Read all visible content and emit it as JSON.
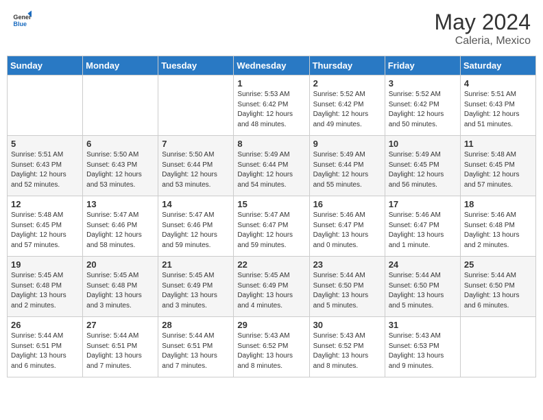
{
  "header": {
    "logo_general": "General",
    "logo_blue": "Blue",
    "month_year": "May 2024",
    "location": "Caleria, Mexico"
  },
  "days_of_week": [
    "Sunday",
    "Monday",
    "Tuesday",
    "Wednesday",
    "Thursday",
    "Friday",
    "Saturday"
  ],
  "weeks": [
    [
      {
        "day": "",
        "sunrise": "",
        "sunset": "",
        "daylight": ""
      },
      {
        "day": "",
        "sunrise": "",
        "sunset": "",
        "daylight": ""
      },
      {
        "day": "",
        "sunrise": "",
        "sunset": "",
        "daylight": ""
      },
      {
        "day": "1",
        "sunrise": "Sunrise: 5:53 AM",
        "sunset": "Sunset: 6:42 PM",
        "daylight": "Daylight: 12 hours and 48 minutes."
      },
      {
        "day": "2",
        "sunrise": "Sunrise: 5:52 AM",
        "sunset": "Sunset: 6:42 PM",
        "daylight": "Daylight: 12 hours and 49 minutes."
      },
      {
        "day": "3",
        "sunrise": "Sunrise: 5:52 AM",
        "sunset": "Sunset: 6:42 PM",
        "daylight": "Daylight: 12 hours and 50 minutes."
      },
      {
        "day": "4",
        "sunrise": "Sunrise: 5:51 AM",
        "sunset": "Sunset: 6:43 PM",
        "daylight": "Daylight: 12 hours and 51 minutes."
      }
    ],
    [
      {
        "day": "5",
        "sunrise": "Sunrise: 5:51 AM",
        "sunset": "Sunset: 6:43 PM",
        "daylight": "Daylight: 12 hours and 52 minutes."
      },
      {
        "day": "6",
        "sunrise": "Sunrise: 5:50 AM",
        "sunset": "Sunset: 6:43 PM",
        "daylight": "Daylight: 12 hours and 53 minutes."
      },
      {
        "day": "7",
        "sunrise": "Sunrise: 5:50 AM",
        "sunset": "Sunset: 6:44 PM",
        "daylight": "Daylight: 12 hours and 53 minutes."
      },
      {
        "day": "8",
        "sunrise": "Sunrise: 5:49 AM",
        "sunset": "Sunset: 6:44 PM",
        "daylight": "Daylight: 12 hours and 54 minutes."
      },
      {
        "day": "9",
        "sunrise": "Sunrise: 5:49 AM",
        "sunset": "Sunset: 6:44 PM",
        "daylight": "Daylight: 12 hours and 55 minutes."
      },
      {
        "day": "10",
        "sunrise": "Sunrise: 5:49 AM",
        "sunset": "Sunset: 6:45 PM",
        "daylight": "Daylight: 12 hours and 56 minutes."
      },
      {
        "day": "11",
        "sunrise": "Sunrise: 5:48 AM",
        "sunset": "Sunset: 6:45 PM",
        "daylight": "Daylight: 12 hours and 57 minutes."
      }
    ],
    [
      {
        "day": "12",
        "sunrise": "Sunrise: 5:48 AM",
        "sunset": "Sunset: 6:45 PM",
        "daylight": "Daylight: 12 hours and 57 minutes."
      },
      {
        "day": "13",
        "sunrise": "Sunrise: 5:47 AM",
        "sunset": "Sunset: 6:46 PM",
        "daylight": "Daylight: 12 hours and 58 minutes."
      },
      {
        "day": "14",
        "sunrise": "Sunrise: 5:47 AM",
        "sunset": "Sunset: 6:46 PM",
        "daylight": "Daylight: 12 hours and 59 minutes."
      },
      {
        "day": "15",
        "sunrise": "Sunrise: 5:47 AM",
        "sunset": "Sunset: 6:47 PM",
        "daylight": "Daylight: 12 hours and 59 minutes."
      },
      {
        "day": "16",
        "sunrise": "Sunrise: 5:46 AM",
        "sunset": "Sunset: 6:47 PM",
        "daylight": "Daylight: 13 hours and 0 minutes."
      },
      {
        "day": "17",
        "sunrise": "Sunrise: 5:46 AM",
        "sunset": "Sunset: 6:47 PM",
        "daylight": "Daylight: 13 hours and 1 minute."
      },
      {
        "day": "18",
        "sunrise": "Sunrise: 5:46 AM",
        "sunset": "Sunset: 6:48 PM",
        "daylight": "Daylight: 13 hours and 2 minutes."
      }
    ],
    [
      {
        "day": "19",
        "sunrise": "Sunrise: 5:45 AM",
        "sunset": "Sunset: 6:48 PM",
        "daylight": "Daylight: 13 hours and 2 minutes."
      },
      {
        "day": "20",
        "sunrise": "Sunrise: 5:45 AM",
        "sunset": "Sunset: 6:48 PM",
        "daylight": "Daylight: 13 hours and 3 minutes."
      },
      {
        "day": "21",
        "sunrise": "Sunrise: 5:45 AM",
        "sunset": "Sunset: 6:49 PM",
        "daylight": "Daylight: 13 hours and 3 minutes."
      },
      {
        "day": "22",
        "sunrise": "Sunrise: 5:45 AM",
        "sunset": "Sunset: 6:49 PM",
        "daylight": "Daylight: 13 hours and 4 minutes."
      },
      {
        "day": "23",
        "sunrise": "Sunrise: 5:44 AM",
        "sunset": "Sunset: 6:50 PM",
        "daylight": "Daylight: 13 hours and 5 minutes."
      },
      {
        "day": "24",
        "sunrise": "Sunrise: 5:44 AM",
        "sunset": "Sunset: 6:50 PM",
        "daylight": "Daylight: 13 hours and 5 minutes."
      },
      {
        "day": "25",
        "sunrise": "Sunrise: 5:44 AM",
        "sunset": "Sunset: 6:50 PM",
        "daylight": "Daylight: 13 hours and 6 minutes."
      }
    ],
    [
      {
        "day": "26",
        "sunrise": "Sunrise: 5:44 AM",
        "sunset": "Sunset: 6:51 PM",
        "daylight": "Daylight: 13 hours and 6 minutes."
      },
      {
        "day": "27",
        "sunrise": "Sunrise: 5:44 AM",
        "sunset": "Sunset: 6:51 PM",
        "daylight": "Daylight: 13 hours and 7 minutes."
      },
      {
        "day": "28",
        "sunrise": "Sunrise: 5:44 AM",
        "sunset": "Sunset: 6:51 PM",
        "daylight": "Daylight: 13 hours and 7 minutes."
      },
      {
        "day": "29",
        "sunrise": "Sunrise: 5:43 AM",
        "sunset": "Sunset: 6:52 PM",
        "daylight": "Daylight: 13 hours and 8 minutes."
      },
      {
        "day": "30",
        "sunrise": "Sunrise: 5:43 AM",
        "sunset": "Sunset: 6:52 PM",
        "daylight": "Daylight: 13 hours and 8 minutes."
      },
      {
        "day": "31",
        "sunrise": "Sunrise: 5:43 AM",
        "sunset": "Sunset: 6:53 PM",
        "daylight": "Daylight: 13 hours and 9 minutes."
      },
      {
        "day": "",
        "sunrise": "",
        "sunset": "",
        "daylight": ""
      }
    ]
  ]
}
